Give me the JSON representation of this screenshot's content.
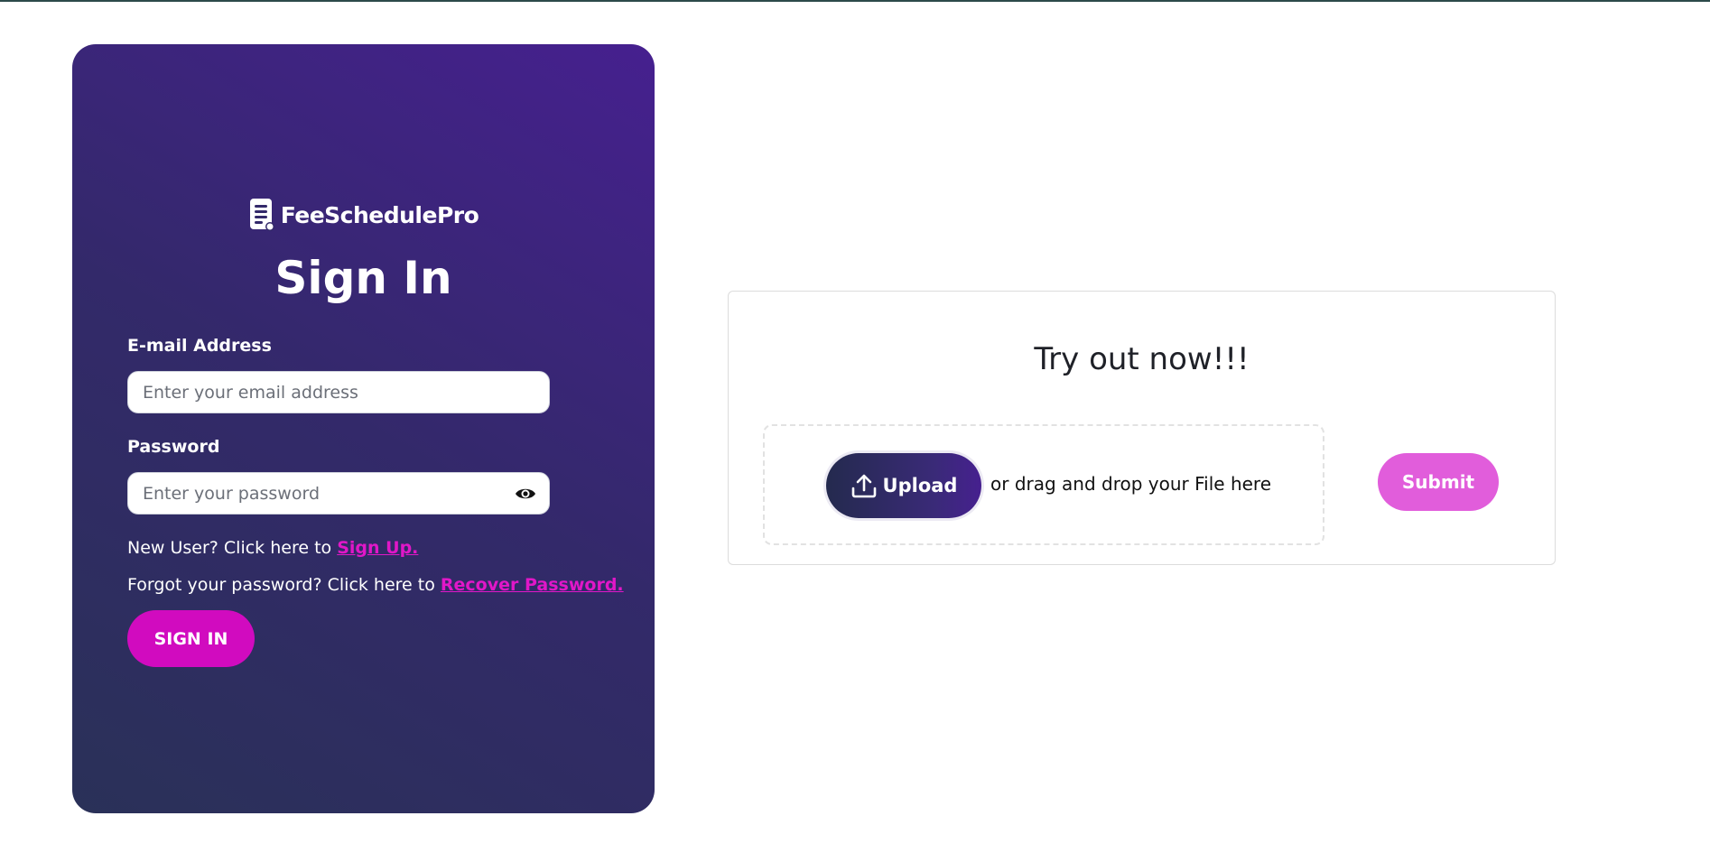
{
  "brand": {
    "name": "FeeSchedulePro",
    "icon": "document-icon"
  },
  "signin": {
    "title": "Sign In",
    "email_label": "E-mail Address",
    "email_placeholder": "Enter your email address",
    "email_value": "",
    "password_label": "Password",
    "password_placeholder": "Enter your password",
    "password_value": "",
    "password_toggle_icon": "eye-icon",
    "signup_prompt": "New User? Click here to ",
    "signup_link": "Sign Up.",
    "recover_prompt": "Forgot your password? Click here to ",
    "recover_link": "Recover Password.",
    "button_label": "SIGN IN"
  },
  "tryout": {
    "title": "Try out now!!!",
    "upload_label": "Upload",
    "upload_icon": "upload-icon",
    "drop_text": "or drag and drop your File here",
    "submit_label": "Submit"
  },
  "colors": {
    "card_gradient_start": "#2a3158",
    "card_gradient_end": "#46208f",
    "accent_pink": "#d10bbf",
    "submit_pink": "#e15ddb",
    "link_pink": "#e117c8"
  }
}
